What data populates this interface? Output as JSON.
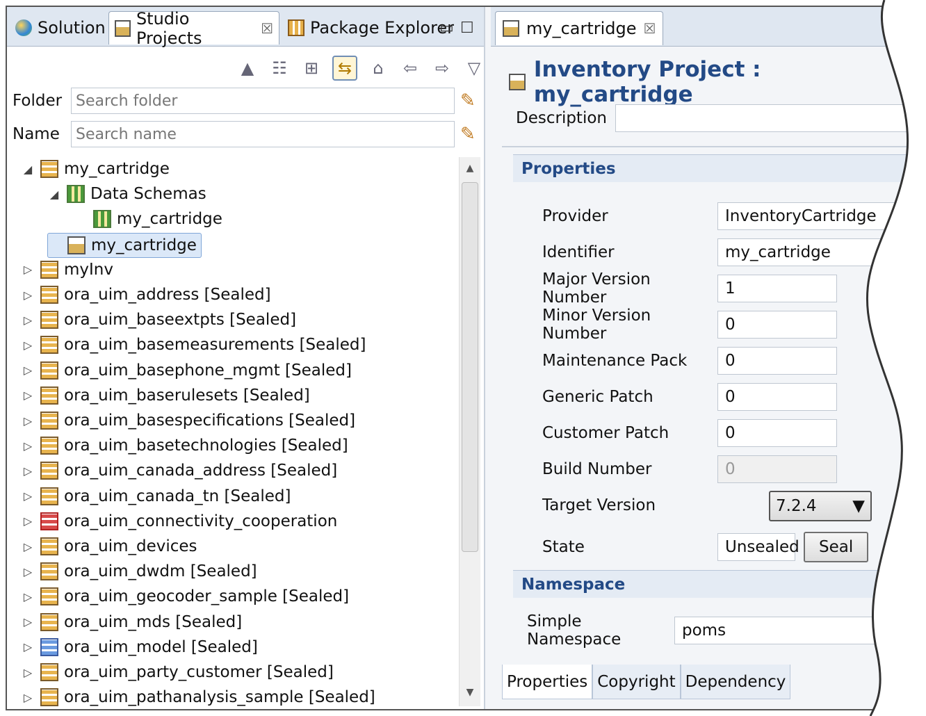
{
  "left_tabs": [
    {
      "label": "Solution",
      "icon": "solution-icon"
    },
    {
      "label": "Studio Projects",
      "icon": "project-icon",
      "close": "☒"
    },
    {
      "label": "Package Explorer",
      "icon": "package-icon"
    }
  ],
  "left_tab_controls": {
    "minimize": "▭",
    "maximize": "☐"
  },
  "toolbar_icons": [
    "collapse-icon",
    "tree-view-icon",
    "grid-icon",
    "link-with-editor-icon",
    "home-icon",
    "back-icon",
    "forward-icon",
    "view-menu-icon"
  ],
  "filters": {
    "folder_label": "Folder",
    "folder_placeholder": "Search folder",
    "name_label": "Name",
    "name_placeholder": "Search name"
  },
  "tree": [
    {
      "label": "my_cartridge",
      "level": 0,
      "expanded": true,
      "icon": "cartridge"
    },
    {
      "label": "Data Schemas",
      "level": 1,
      "expanded": true,
      "icon": "schema"
    },
    {
      "label": "my_cartridge",
      "level": 2,
      "leaf": true,
      "icon": "schema"
    },
    {
      "label": "my_cartridge",
      "level": 1,
      "leaf": true,
      "icon": "project",
      "selected": true
    },
    {
      "label": "myInv",
      "level": 0,
      "icon": "cartridge"
    },
    {
      "label": "ora_uim_address [Sealed]",
      "level": 0,
      "icon": "cartridge"
    },
    {
      "label": "ora_uim_baseextpts [Sealed]",
      "level": 0,
      "icon": "cartridge"
    },
    {
      "label": "ora_uim_basemeasurements [Sealed]",
      "level": 0,
      "icon": "cartridge"
    },
    {
      "label": "ora_uim_basephone_mgmt [Sealed]",
      "level": 0,
      "icon": "cartridge"
    },
    {
      "label": "ora_uim_baserulesets [Sealed]",
      "level": 0,
      "icon": "cartridge"
    },
    {
      "label": "ora_uim_basespecifications [Sealed]",
      "level": 0,
      "icon": "cartridge"
    },
    {
      "label": "ora_uim_basetechnologies [Sealed]",
      "level": 0,
      "icon": "cartridge"
    },
    {
      "label": "ora_uim_canada_address [Sealed]",
      "level": 0,
      "icon": "cartridge"
    },
    {
      "label": "ora_uim_canada_tn [Sealed]",
      "level": 0,
      "icon": "cartridge"
    },
    {
      "label": "ora_uim_connectivity_cooperation",
      "level": 0,
      "icon": "error"
    },
    {
      "label": "ora_uim_devices",
      "level": 0,
      "icon": "cartridge"
    },
    {
      "label": "ora_uim_dwdm [Sealed]",
      "level": 0,
      "icon": "cartridge"
    },
    {
      "label": "ora_uim_geocoder_sample [Sealed]",
      "level": 0,
      "icon": "cartridge"
    },
    {
      "label": "ora_uim_mds [Sealed]",
      "level": 0,
      "icon": "cartridge"
    },
    {
      "label": "ora_uim_model [Sealed]",
      "level": 0,
      "icon": "model"
    },
    {
      "label": "ora_uim_party_customer [Sealed]",
      "level": 0,
      "icon": "cartridge"
    },
    {
      "label": "ora_uim_pathanalysis_sample [Sealed]",
      "level": 0,
      "icon": "cartridge"
    }
  ],
  "editor": {
    "tab_label": "my_cartridge",
    "tab_close": "☒",
    "title": "Inventory Project : my_cartridge",
    "description_label": "Description",
    "properties_header": "Properties",
    "properties": [
      {
        "label": "Provider",
        "value": "InventoryCartridge"
      },
      {
        "label": "Identifier",
        "value": "my_cartridge"
      },
      {
        "label": "Major Version Number",
        "value": "1"
      },
      {
        "label": "Minor Version Number",
        "value": "0"
      },
      {
        "label": "Maintenance Pack",
        "value": "0"
      },
      {
        "label": "Generic Patch",
        "value": "0"
      },
      {
        "label": "Customer Patch",
        "value": "0"
      },
      {
        "label": "Build Number",
        "value": "0",
        "disabled": true
      }
    ],
    "target_version_label": "Target Version",
    "target_version_value": "7.2.4",
    "state_label": "State",
    "state_value": "Unsealed",
    "seal_button": "Seal",
    "namespace_header": "Namespace",
    "simple_namespace_label": "Simple Namespace",
    "simple_namespace_value": "poms",
    "bottom_tabs": [
      "Properties",
      "Copyright",
      "Dependency"
    ]
  },
  "colors": {
    "accent": "#234a86",
    "tab_bar": "#dfe7f1",
    "selection": "#dbe8f8"
  }
}
